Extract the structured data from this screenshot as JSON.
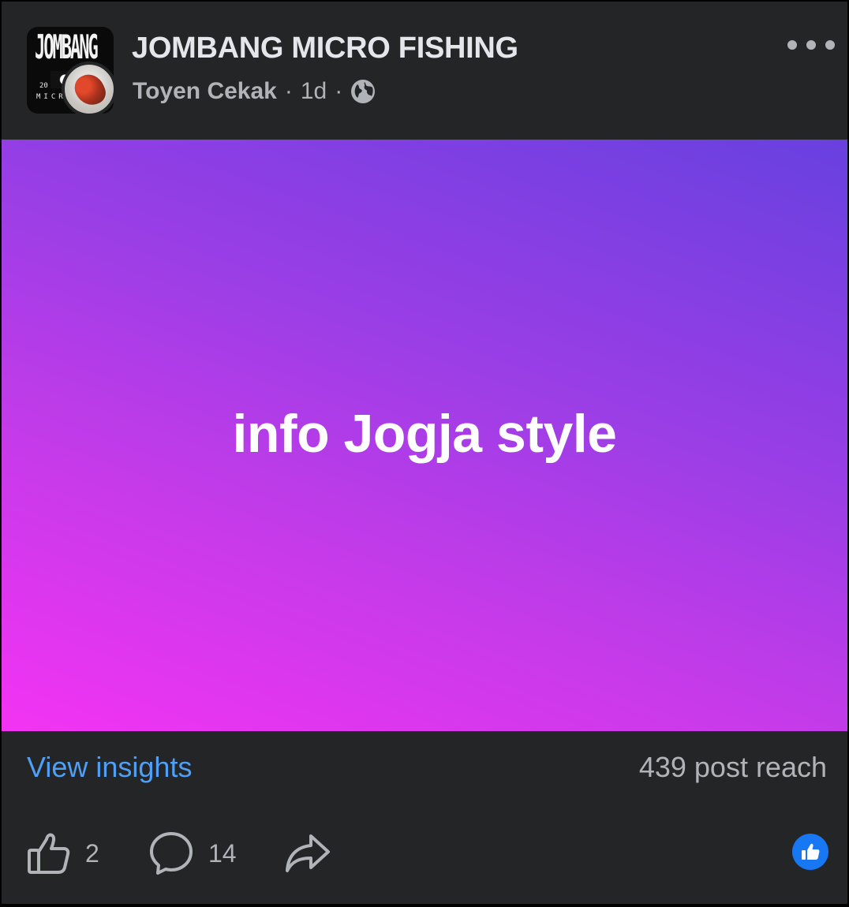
{
  "post": {
    "group_name": "JOMBANG MICRO FISHING",
    "author": "Toyen Cekak",
    "separator": "·",
    "time": "1d",
    "audience_icon": "globe-icon",
    "group_logo": {
      "title": "JOMBANG",
      "year_fragment": "20",
      "subtitle_fragment": "MICR"
    },
    "text": "info Jogja style",
    "background_gradient": [
      "#f333f3",
      "#c23be9",
      "#9b3ee6",
      "#6840df"
    ]
  },
  "insights": {
    "link_label": "View insights",
    "reach_label": "439 post reach"
  },
  "actions": {
    "like_count": "2",
    "comment_count": "14",
    "like_icon": "thumbs-up-icon",
    "comment_icon": "comment-bubble-icon",
    "share_icon": "share-arrow-icon",
    "reaction_icon": "like-reaction-icon"
  },
  "colors": {
    "background": "#242526",
    "primary_text": "#e4e6eb",
    "secondary_text": "#b0b3b8",
    "link": "#4e9ff5",
    "reaction_blue": "#1877f2"
  }
}
